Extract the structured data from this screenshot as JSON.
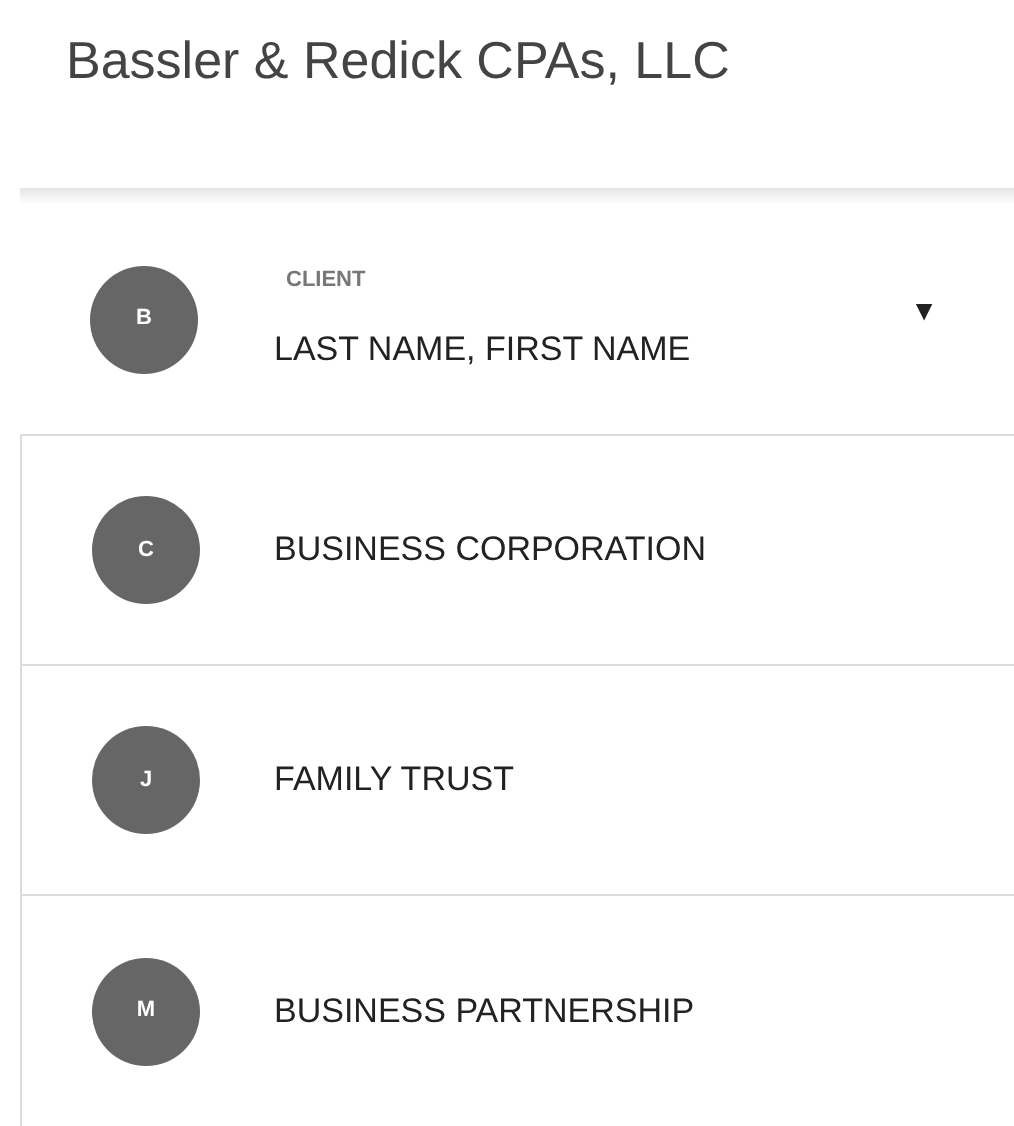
{
  "title": "Bassler & Redick CPAs, LLC",
  "client_select": {
    "avatar": "B",
    "label": "CLIENT",
    "value": "LAST NAME, FIRST NAME",
    "caret": "▼"
  },
  "options": [
    {
      "avatar": "C",
      "label": "BUSINESS CORPORATION"
    },
    {
      "avatar": "J",
      "label": "FAMILY TRUST"
    },
    {
      "avatar": "M",
      "label": "BUSINESS PARTNERSHIP"
    }
  ]
}
